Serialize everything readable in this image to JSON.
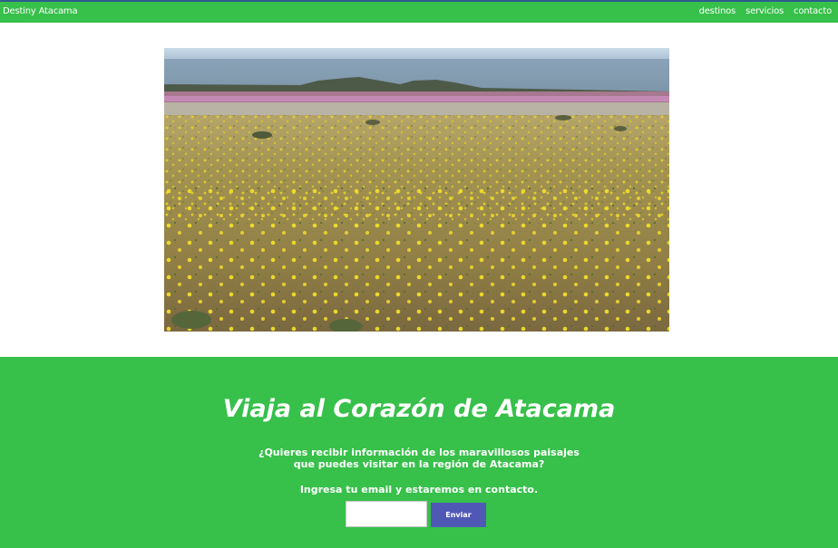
{
  "header": {
    "brand": "Destiny Atacama",
    "nav": [
      {
        "label": "destinos"
      },
      {
        "label": "servicios"
      },
      {
        "label": "contacto"
      }
    ]
  },
  "hero": {
    "alt": "Desierto florido"
  },
  "cta": {
    "title": "Viaja al Corazón de Atacama",
    "question_line1": "¿Quieres recibir información de los maravillosos paisajes",
    "question_line2": "que puedes visitar en la región de Atacama?",
    "prompt": "Ingresa tu email y estaremos en contacto.",
    "email_value": "",
    "email_placeholder": "",
    "send_label": "Enviar"
  },
  "colors": {
    "nav_bg": "#37c04a",
    "cta_bg": "#37c04a",
    "button_bg": "#5058b6"
  }
}
